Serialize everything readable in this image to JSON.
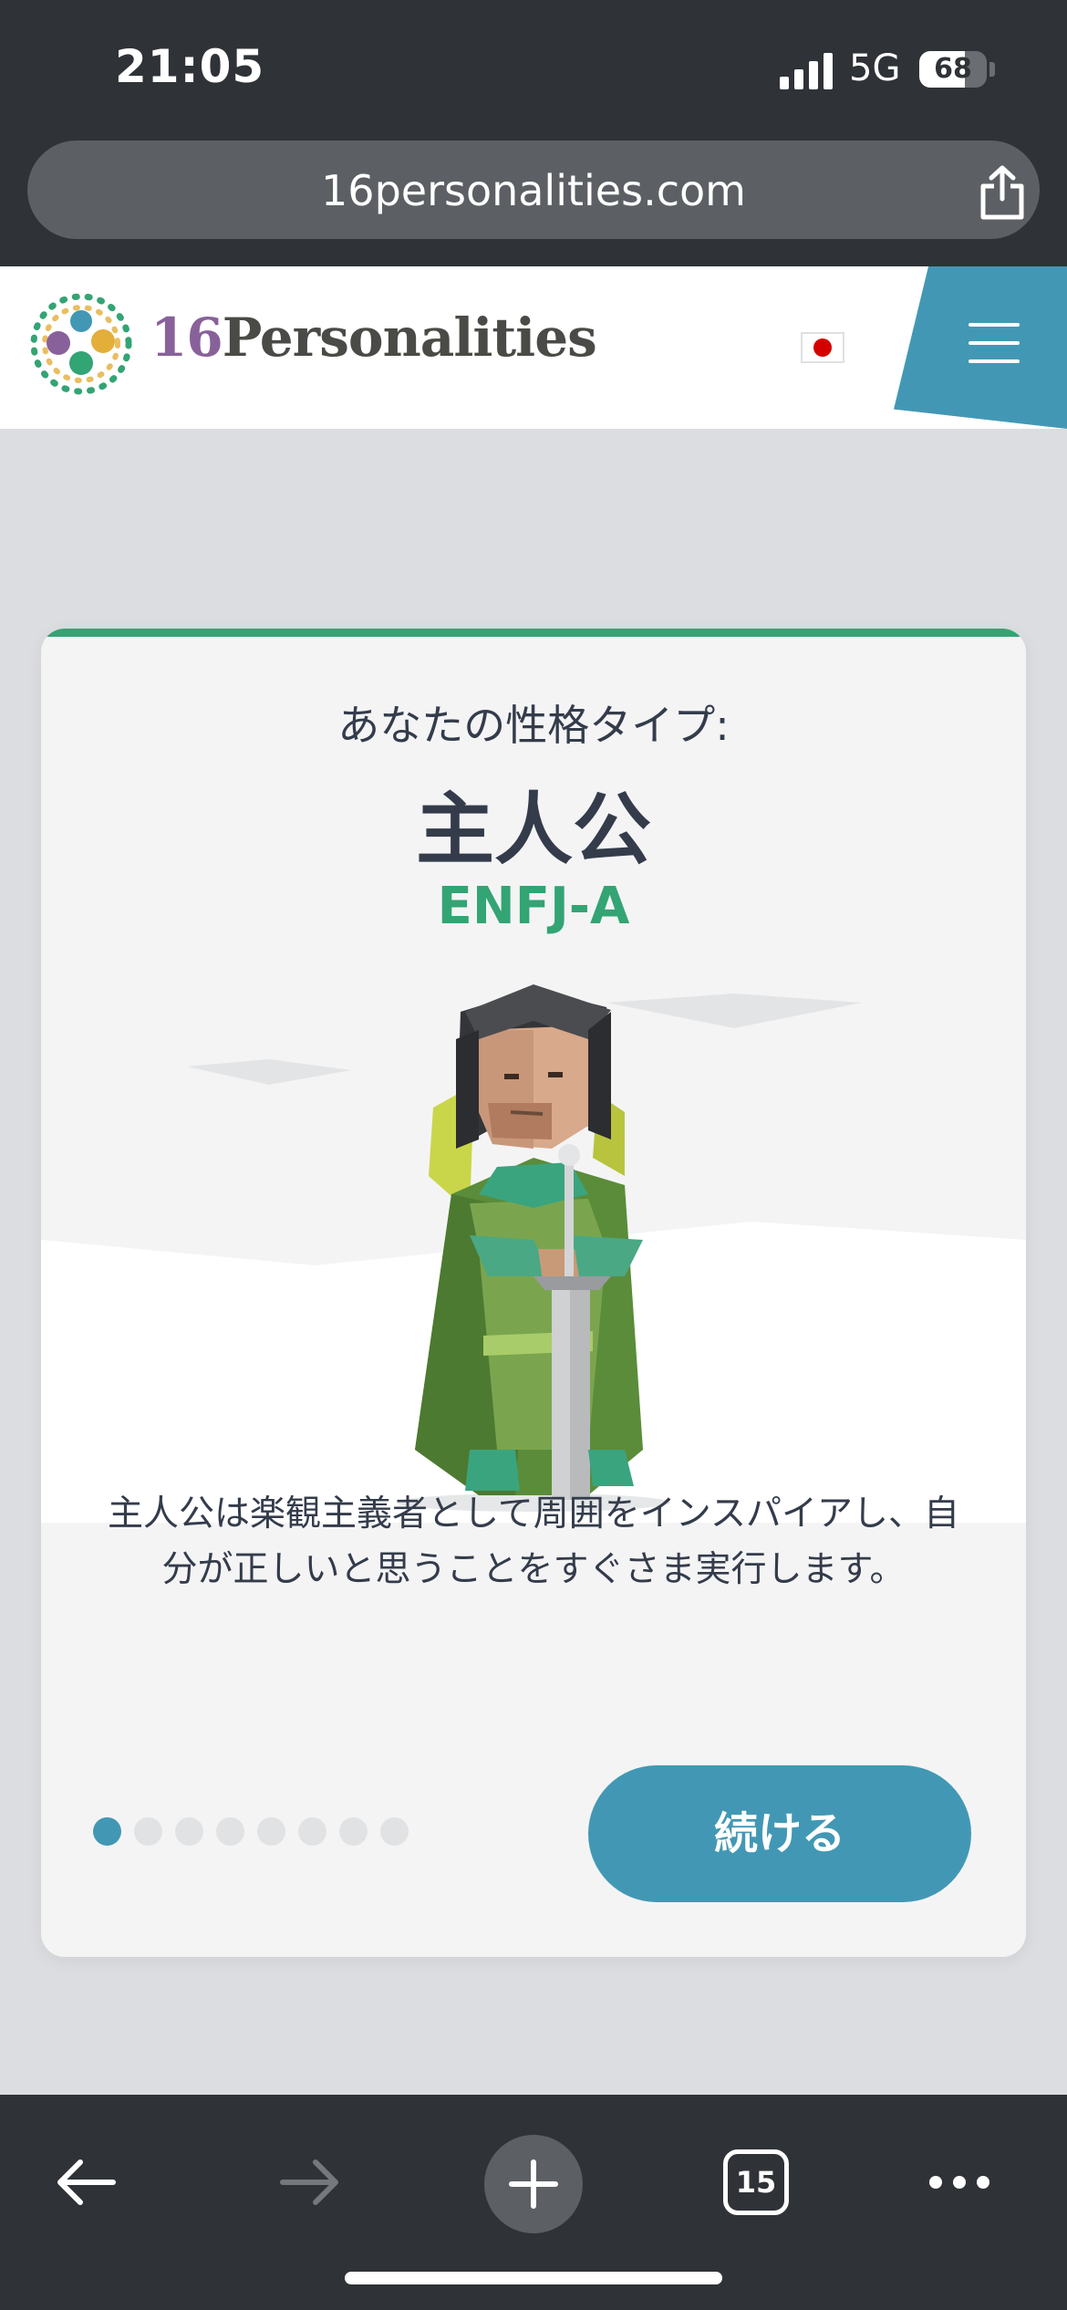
{
  "status_bar": {
    "time": "21:05",
    "network": "5G",
    "battery_level": "68",
    "battery_fraction": 0.68
  },
  "browser": {
    "url": "16personalities.com",
    "tab_count": "15",
    "icons": {
      "share": "share-icon",
      "back": "back-arrow-icon",
      "forward": "forward-arrow-icon",
      "new_tab": "plus-icon",
      "tabs": "tabs-icon",
      "more": "more-dots-icon"
    }
  },
  "site_header": {
    "logo_number": "16",
    "logo_word": "Personalities",
    "language_flag": "japan-flag",
    "menu_icon": "hamburger-menu-icon"
  },
  "result_card": {
    "type_label": "あなたの性格タイプ:",
    "type_name": "主人公",
    "type_code": "ENFJ-A",
    "description": "主人公は楽観主義者として周囲をインスパイアし、自分が正しいと思うことをすぐさま実行します。",
    "continue_label": "続ける",
    "pager": {
      "total": 8,
      "active_index": 0
    }
  },
  "colors": {
    "accent_green": "#33a474",
    "accent_blue": "#4298b4",
    "text_dark": "#343c4b",
    "browser_chrome": "#2f3236"
  }
}
